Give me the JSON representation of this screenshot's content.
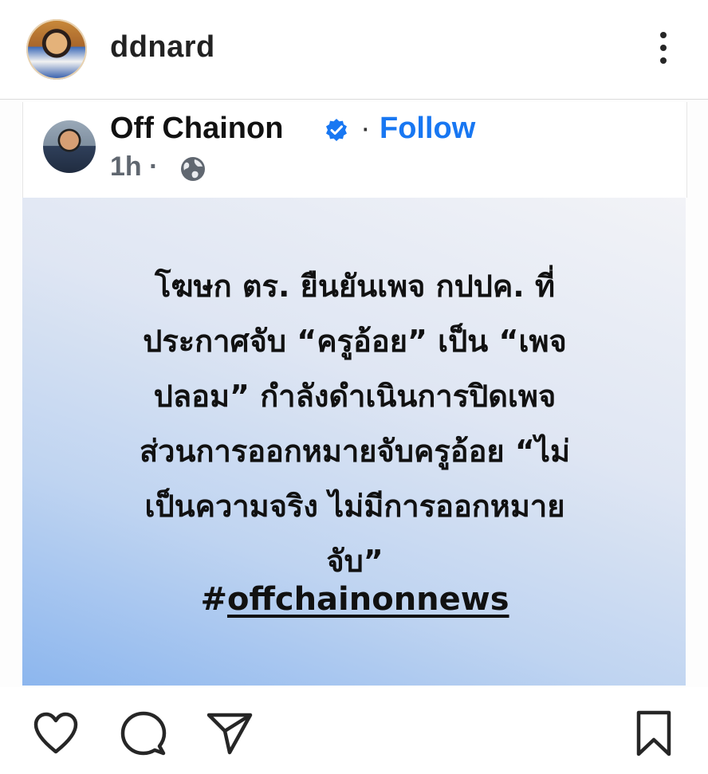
{
  "post_header": {
    "username": "ddnard"
  },
  "embedded_post": {
    "author": "Off Chainon",
    "separator": "·",
    "follow_label": "Follow",
    "time_ago": "1h ·",
    "accent_color": "#1877f2"
  },
  "quote": {
    "lines": [
      "โฆษก ตร. ยืนยันเพจ กปปค. ที่",
      "ประกาศจับ “ครูอ้อย” เป็น “เพจ",
      "ปลอม” กำลังดำเนินการปิดเพจ",
      "ส่วนการออกหมายจับครูอ้อย “ไม่",
      "เป็นความจริง ไม่มีการออกหมาย",
      "จับ”"
    ],
    "hashtag_symbol": "#",
    "hashtag_text": "offchainonnews"
  },
  "icons": {
    "menu": "more-vertical-icon",
    "verified": "verified-badge-icon",
    "privacy": "globe-icon",
    "like": "heart-icon",
    "comment": "comment-icon",
    "share": "send-icon",
    "save": "bookmark-icon"
  }
}
